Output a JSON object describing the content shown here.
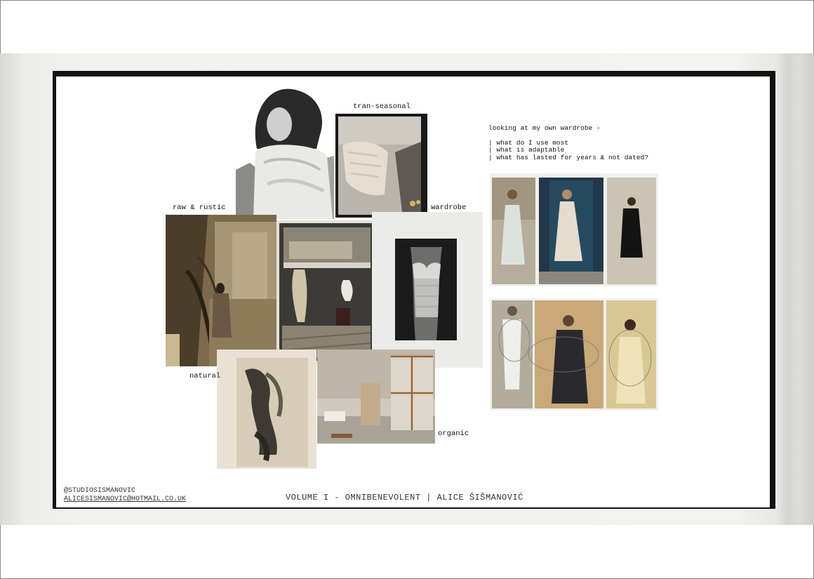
{
  "labels": {
    "tran_seasonal": "tran-seasonal",
    "raw_rustic": "raw & rustic",
    "wardrobe": "wardrobe",
    "natural": "natural",
    "organic": "organic"
  },
  "note": {
    "heading": "looking at my own wardrobe -",
    "lines": [
      "| what do I use most",
      "| what is adaptable",
      "| what has lasted for years & not dated?"
    ]
  },
  "footer": {
    "handle": "@STUDIOSISMANOVIC",
    "email": "ALICESISMANOVIC@HOTMAIL.CO.UK",
    "title": "VOLUME I - OMNIBENEVOLENT | ALICE ŠIŠMANOVIĆ"
  },
  "colors": {
    "frame": "#111111",
    "paper": "#f1f1ef"
  }
}
